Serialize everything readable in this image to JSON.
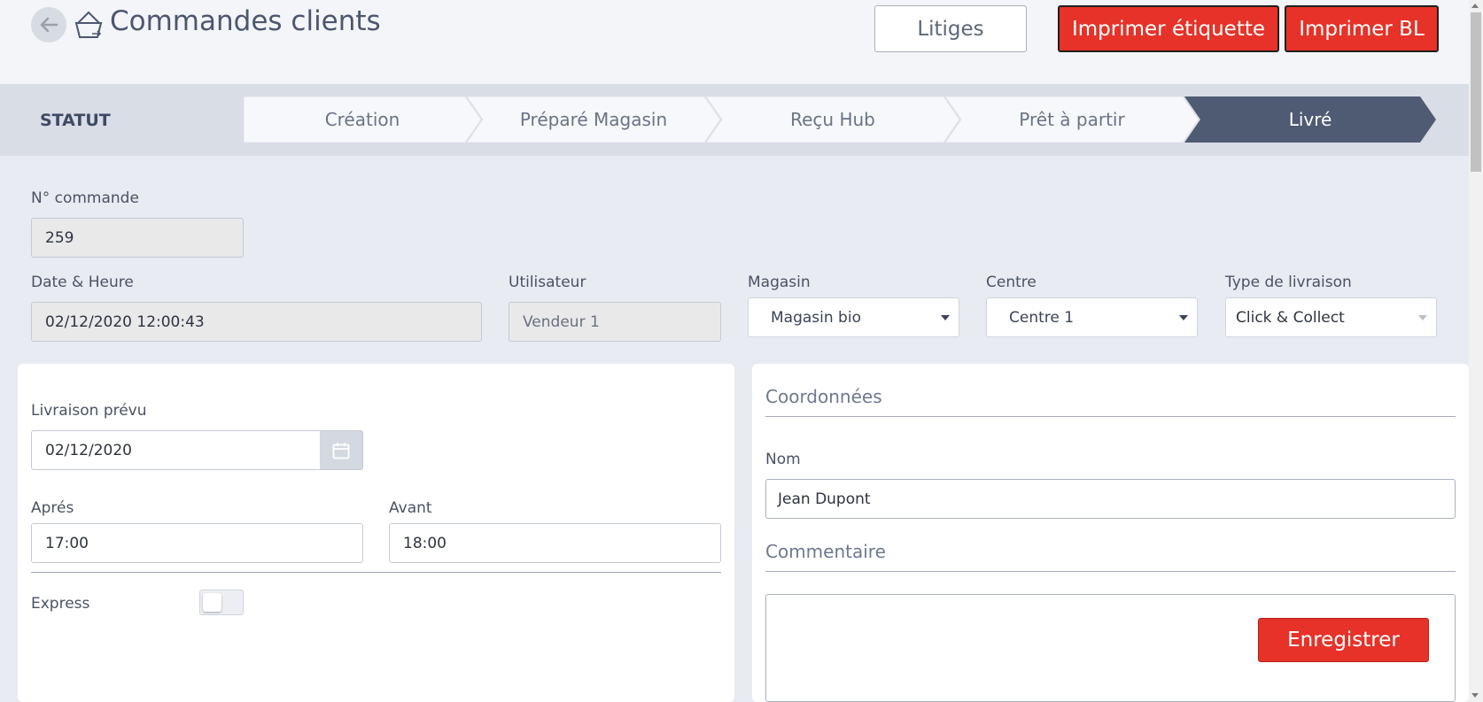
{
  "header": {
    "title": "Commandes clients",
    "back_icon": "arrow-left-icon",
    "page_icon": "basket-icon",
    "buttons": {
      "litiges": "Litiges",
      "print_label": "Imprimer étiquette",
      "print_bl": "Imprimer BL"
    }
  },
  "status": {
    "label": "STATUT",
    "steps": [
      "Création",
      "Préparé Magasin",
      "Reçu Hub",
      "Prêt à partir",
      "Livré"
    ],
    "active": "Livré"
  },
  "form": {
    "order_number": {
      "label": "N° commande",
      "value": "259"
    },
    "datetime": {
      "label": "Date & Heure",
      "value": "02/12/2020 12:00:43"
    },
    "user": {
      "label": "Utilisateur",
      "value": "Vendeur 1"
    },
    "store": {
      "label": "Magasin",
      "value": "Magasin bio"
    },
    "center": {
      "label": "Centre",
      "value": "Centre 1"
    },
    "delivery_type": {
      "label": "Type de livraison",
      "value": "Click & Collect"
    }
  },
  "delivery": {
    "planned": {
      "label": "Livraison prévu",
      "value": "02/12/2020"
    },
    "after": {
      "label": "Aprés",
      "value": "17:00"
    },
    "before": {
      "label": "Avant",
      "value": "18:00"
    },
    "express": {
      "label": "Express",
      "on": false
    }
  },
  "contact": {
    "section_title": "Coordonnées",
    "name": {
      "label": "Nom",
      "value": "Jean Dupont"
    },
    "comment_title": "Commentaire",
    "save_label": "Enregistrer"
  },
  "colors": {
    "accent_red": "#e63228",
    "active_step": "#4f5b73",
    "background": "#e8ebf2"
  }
}
